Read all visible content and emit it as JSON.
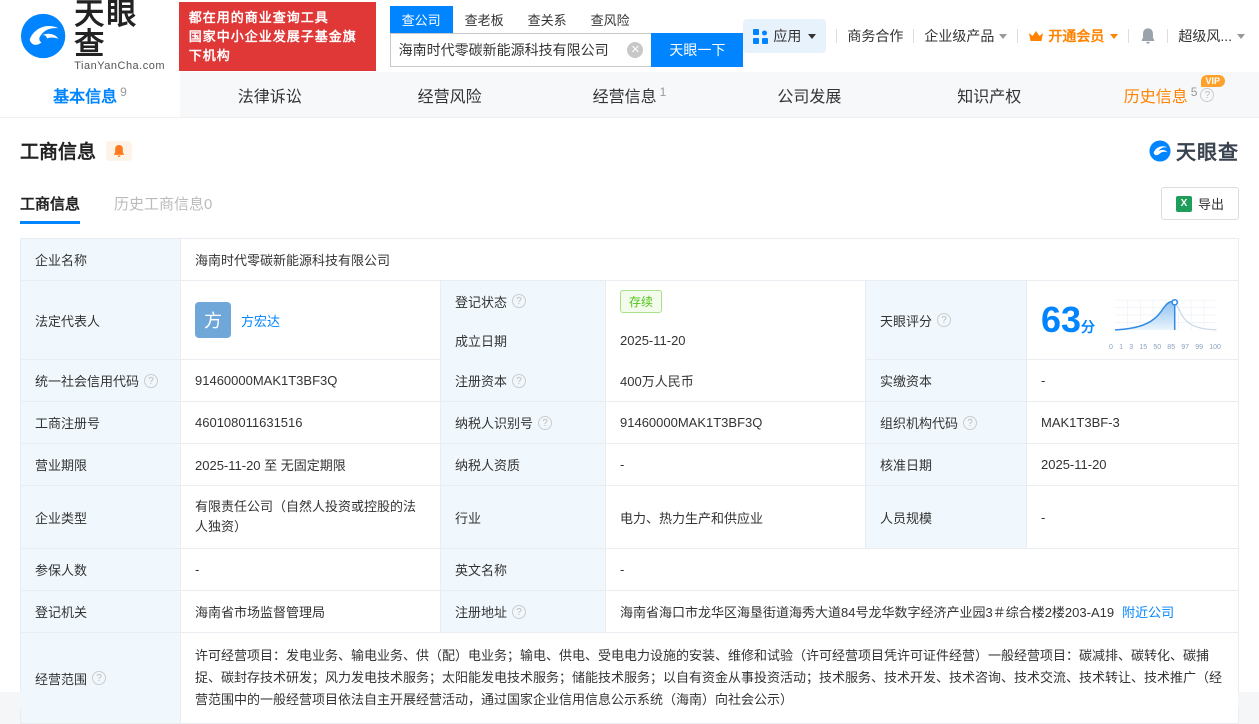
{
  "colors": {
    "primary": "#0084ff",
    "slogan_red": "#e03737",
    "vip_orange": "#ff8200",
    "status_green": "#52c41a"
  },
  "header": {
    "logo": {
      "title": "天眼查",
      "subtitle": "TianYanCha.com"
    },
    "slogan": {
      "line1": "都在用的商业查询工具",
      "line2": "国家中小企业发展子基金旗下机构"
    },
    "search": {
      "tabs": [
        {
          "label": "查公司"
        },
        {
          "label": "查老板"
        },
        {
          "label": "查关系"
        },
        {
          "label": "查风险"
        }
      ],
      "value": "海南时代零碳新能源科技有限公司",
      "button": "天眼一下"
    },
    "nav": {
      "apps": "应用",
      "cooperation": "商务合作",
      "enterprise": "企业级产品",
      "vip": "开通会员",
      "super_risk": "超级风..."
    }
  },
  "tabs": {
    "basic": {
      "label": "基本信息",
      "count": "9"
    },
    "legal": {
      "label": "法律诉讼"
    },
    "risk": {
      "label": "经营风险"
    },
    "operation": {
      "label": "经营信息",
      "count": "1"
    },
    "development": {
      "label": "公司发展"
    },
    "ip": {
      "label": "知识产权"
    },
    "history": {
      "label": "历史信息",
      "count": "5",
      "vip": "VIP"
    }
  },
  "section": {
    "title": "工商信息",
    "watermark": "天眼查",
    "subtabs": {
      "current": "工商信息",
      "history": "历史工商信息0"
    },
    "export_label": "导出"
  },
  "info": {
    "company_name_label": "企业名称",
    "company_name": "海南时代零碳新能源科技有限公司",
    "legal_rep_label": "法定代表人",
    "legal_rep_avatar": "方",
    "legal_rep_name": "方宏达",
    "reg_status_label": "登记状态",
    "reg_status": "存续",
    "establish_date_label": "成立日期",
    "establish_date": "2025-11-20",
    "score_label": "天眼评分",
    "score": "63",
    "score_unit": "分",
    "score_ticks": [
      "0",
      "1",
      "3",
      "15",
      "50",
      "85",
      "97",
      "99",
      "100"
    ],
    "credit_code_label": "统一社会信用代码",
    "credit_code": "91460000MAK1T3BF3Q",
    "reg_capital_label": "注册资本",
    "reg_capital": "400万人民币",
    "paid_capital_label": "实缴资本",
    "paid_capital": "-",
    "reg_number_label": "工商注册号",
    "reg_number": "460108011631516",
    "taxpayer_id_label": "纳税人识别号",
    "taxpayer_id": "91460000MAK1T3BF3Q",
    "org_code_label": "组织机构代码",
    "org_code": "MAK1T3BF-3",
    "business_term_label": "营业期限",
    "business_term": "2025-11-20 至 无固定期限",
    "taxpayer_quality_label": "纳税人资质",
    "taxpayer_quality": "-",
    "approval_date_label": "核准日期",
    "approval_date": "2025-11-20",
    "company_type_label": "企业类型",
    "company_type": "有限责任公司（自然人投资或控股的法人独资）",
    "industry_label": "行业",
    "industry": "电力、热力生产和供应业",
    "staff_size_label": "人员规模",
    "staff_size": "-",
    "insured_label": "参保人数",
    "insured": "-",
    "english_name_label": "英文名称",
    "english_name": "-",
    "reg_authority_label": "登记机关",
    "reg_authority": "海南省市场监督管理局",
    "address_label": "注册地址",
    "address": "海南省海口市龙华区海垦街道海秀大道84号龙华数字经济产业园3＃综合楼2楼203-A19",
    "nearby_link": "附近公司",
    "business_scope_label": "经营范围",
    "business_scope": "许可经营项目：发电业务、输电业务、供（配）电业务；输电、供电、受电电力设施的安装、维修和试验（许可经营项目凭许可证件经营）一般经营项目：碳减排、碳转化、碳捕捉、碳封存技术研发；风力发电技术服务；太阳能发电技术服务；储能技术服务；以自有资金从事投资活动；技术服务、技术开发、技术咨询、技术交流、技术转让、技术推广（经营范围中的一般经营项目依法自主开展经营活动，通过国家企业信用信息公示系统（海南）向社会公示）"
  }
}
